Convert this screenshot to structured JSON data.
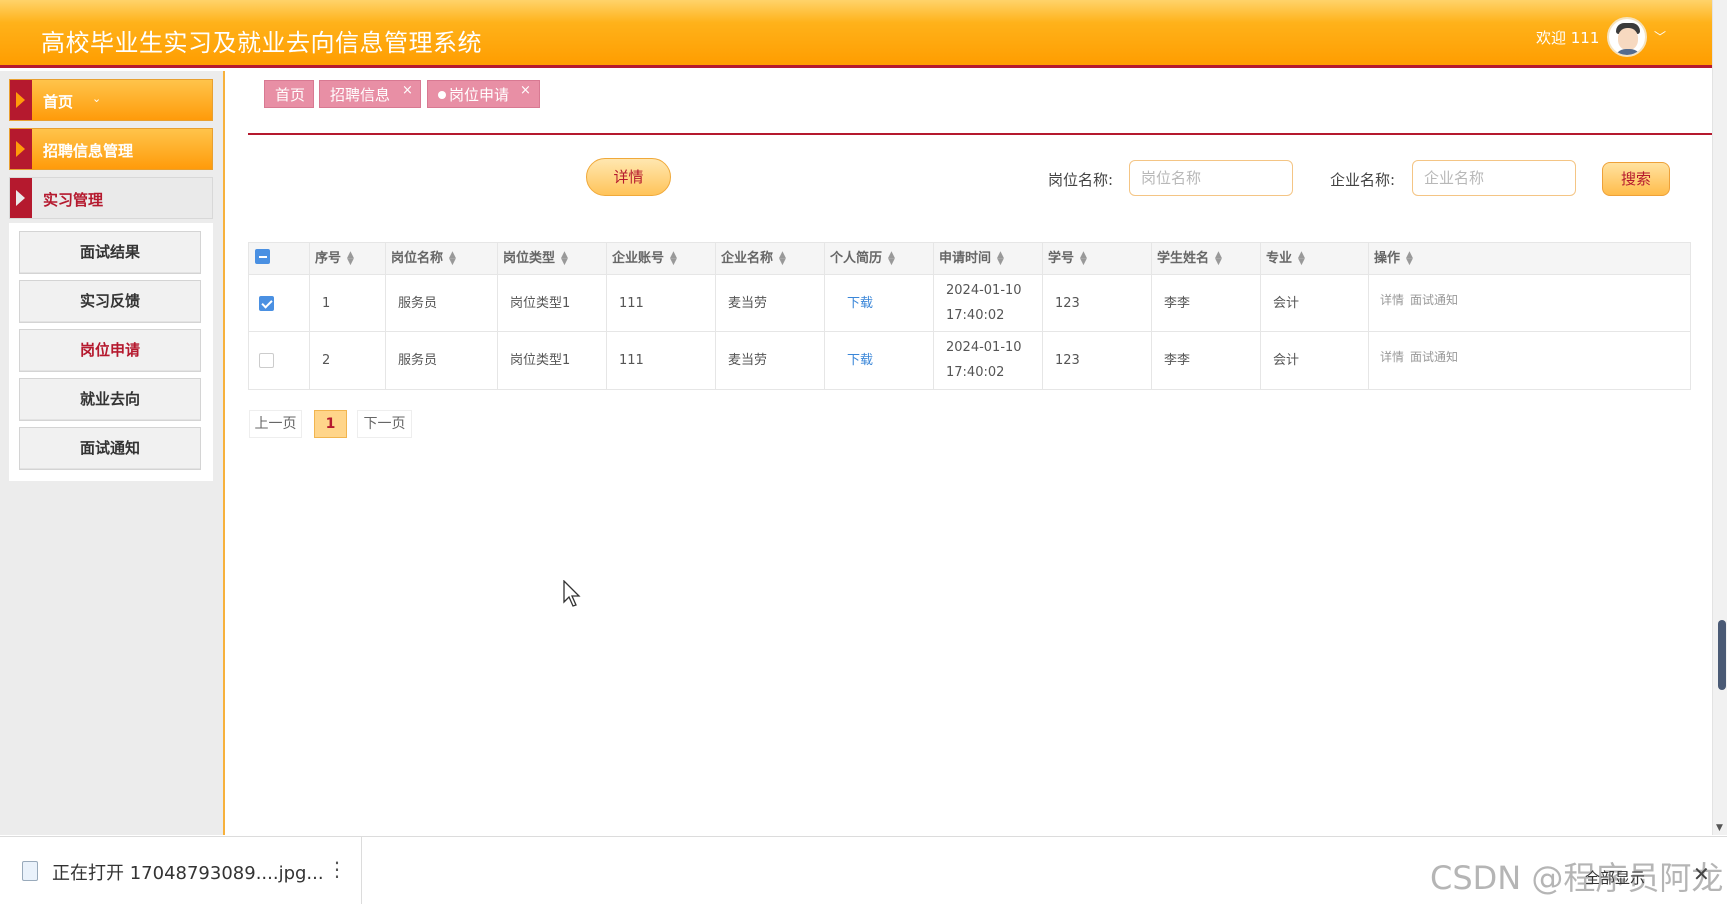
{
  "header": {
    "title": "高校毕业生实习及就业去向信息管理系统",
    "welcome": "欢迎 111",
    "avatar_icon": "user-avatar-icon",
    "chevron_icon": "chevron-down-icon"
  },
  "sidebar": {
    "menu": [
      {
        "label": "首页",
        "chevron": "⌄"
      },
      {
        "label": "招聘信息管理"
      },
      {
        "label": "实习管理"
      }
    ],
    "submenu": [
      {
        "label": "面试结果"
      },
      {
        "label": "实习反馈"
      },
      {
        "label": "岗位申请"
      },
      {
        "label": "就业去向"
      },
      {
        "label": "面试通知"
      }
    ]
  },
  "tabs": [
    {
      "label": "首页"
    },
    {
      "label": "招聘信息",
      "close": "×"
    },
    {
      "label": "岗位申请",
      "close": "×"
    }
  ],
  "toolbar": {
    "detail_label": "详情",
    "job_name_label": "岗位名称:",
    "job_name_placeholder": "岗位名称",
    "company_name_label": "企业名称:",
    "company_name_placeholder": "企业名称",
    "search_label": "搜索"
  },
  "table": {
    "headers": [
      "序号",
      "岗位名称",
      "岗位类型",
      "企业账号",
      "企业名称",
      "个人简历",
      "申请时间",
      "学号",
      "学生姓名",
      "专业",
      "操作"
    ],
    "rows": [
      {
        "checked": true,
        "no": "1",
        "job_name": "服务员",
        "job_type": "岗位类型1",
        "account": "111",
        "company": "麦当劳",
        "resume": "下载",
        "time": "2024-01-10 17:40:02",
        "student_no": "123",
        "student_name": "李李",
        "major": "会计",
        "op_detail": "详情",
        "op_notice": "面试通知"
      },
      {
        "checked": false,
        "no": "2",
        "job_name": "服务员",
        "job_type": "岗位类型1",
        "account": "111",
        "company": "麦当劳",
        "resume": "下载",
        "time": "2024-01-10 17:40:02",
        "student_no": "123",
        "student_name": "李李",
        "major": "会计",
        "op_detail": "详情",
        "op_notice": "面试通知"
      }
    ]
  },
  "pagination": {
    "prev": "上一页",
    "current": "1",
    "next": "下一页"
  },
  "download_bar": {
    "file_text": "正在打开 17048793089....jpg...",
    "show_all": "全部显示",
    "watermark": "CSDN @程序员阿龙"
  },
  "colors": {
    "accent": "#ff9d00",
    "brand_red": "#b5192e",
    "tab_pink": "#e88fa5",
    "link_blue": "#3a86d8"
  }
}
